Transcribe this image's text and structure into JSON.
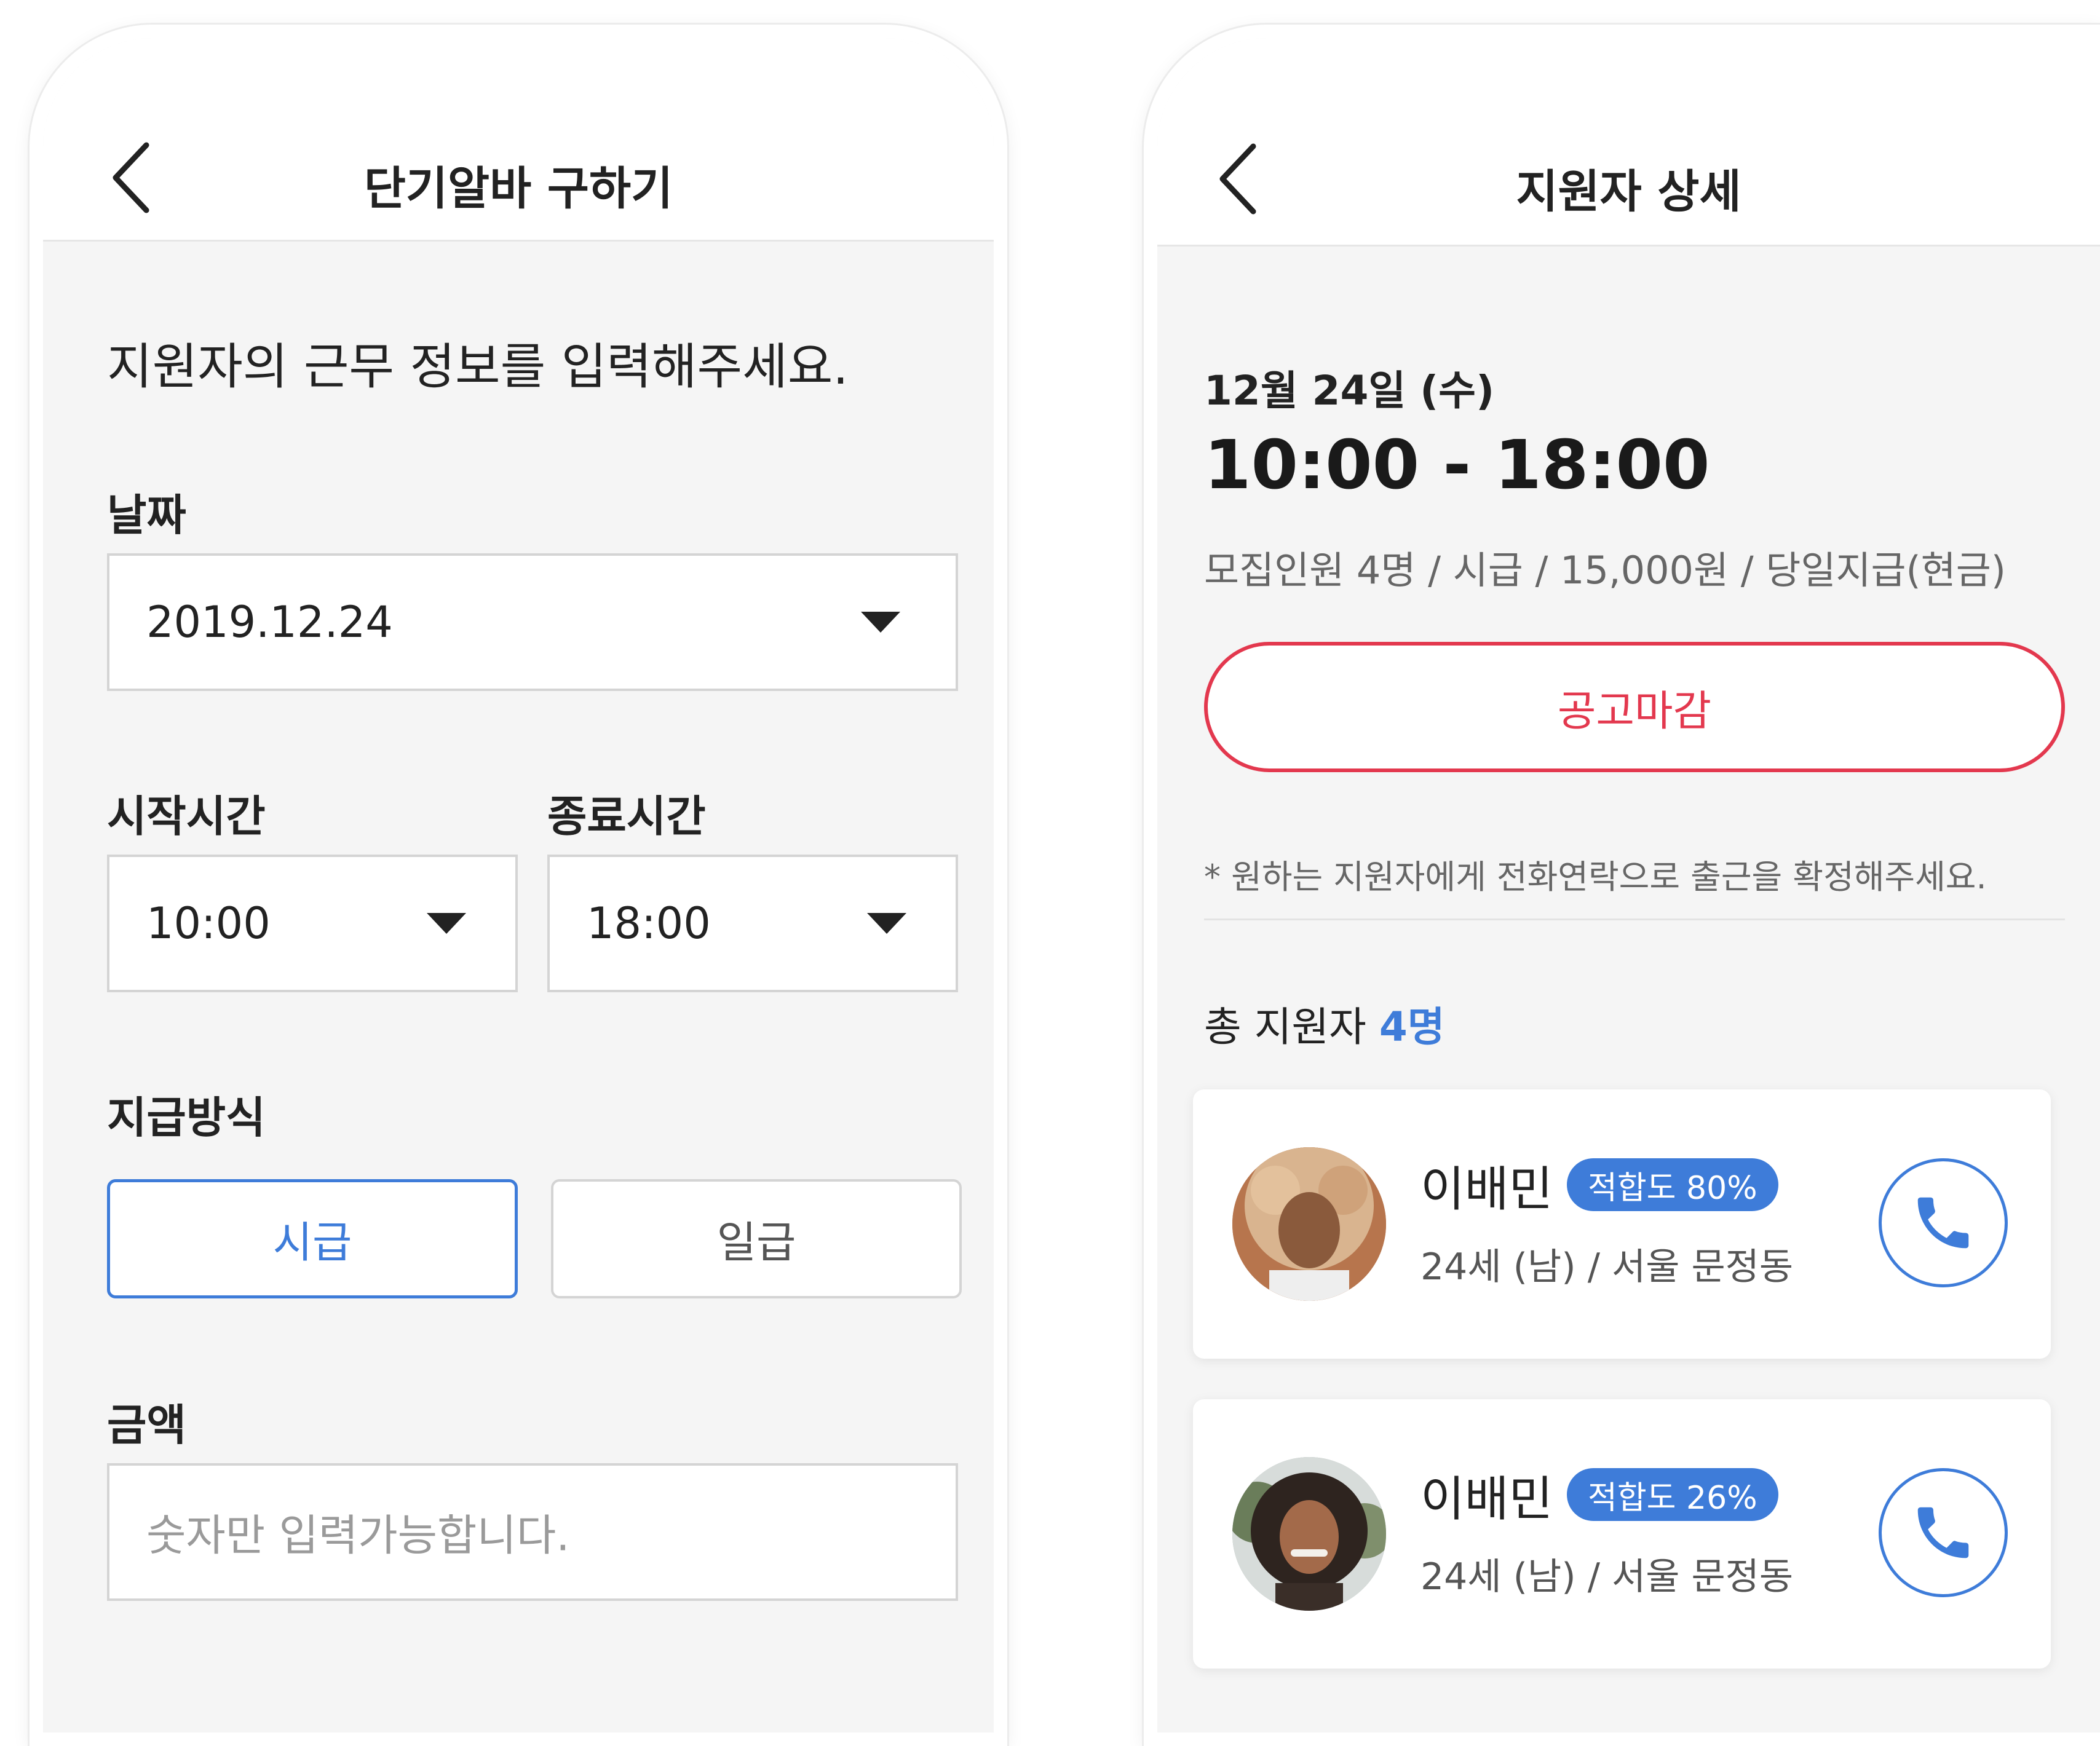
{
  "left": {
    "title": "단기알바 구하기",
    "lead": "지원자의 근무 정보를 입력해주세요.",
    "date_label": "날짜",
    "date_value": "2019.12.24",
    "start_label": "시작시간",
    "start_value": "10:00",
    "end_label": "종료시간",
    "end_value": "18:00",
    "pay_label": "지급방식",
    "pay_options": [
      "시급",
      "일급"
    ],
    "pay_selected": "시급",
    "amount_label": "금액",
    "amount_placeholder": "숫자만 입력가능합니다."
  },
  "right": {
    "title": "지원자 상세",
    "date": "12월 24일 (수)",
    "time": "10:00 - 18:00",
    "meta": "모집인원 4명 / 시급 / 15,000원 / 당일지급(현금)",
    "close_button": "공고마감",
    "notice": "* 원하는 지원자에게 전화연락으로 출근을 확정해주세요.",
    "total_label": "총 지원자",
    "total_count": "4명",
    "applicants": [
      {
        "name": "이배민",
        "match": "적합도 80%",
        "info": "24세 (남)  / 서울 문정동"
      },
      {
        "name": "이배민",
        "match": "적합도 26%",
        "info": "24세 (남)  / 서울 문정동"
      }
    ]
  },
  "colors": {
    "accent": "#3e7cd9",
    "danger": "#e3384e",
    "background": "#f5f5f5"
  },
  "icons": [
    "chevron-left-icon",
    "caret-down-icon",
    "phone-icon"
  ]
}
